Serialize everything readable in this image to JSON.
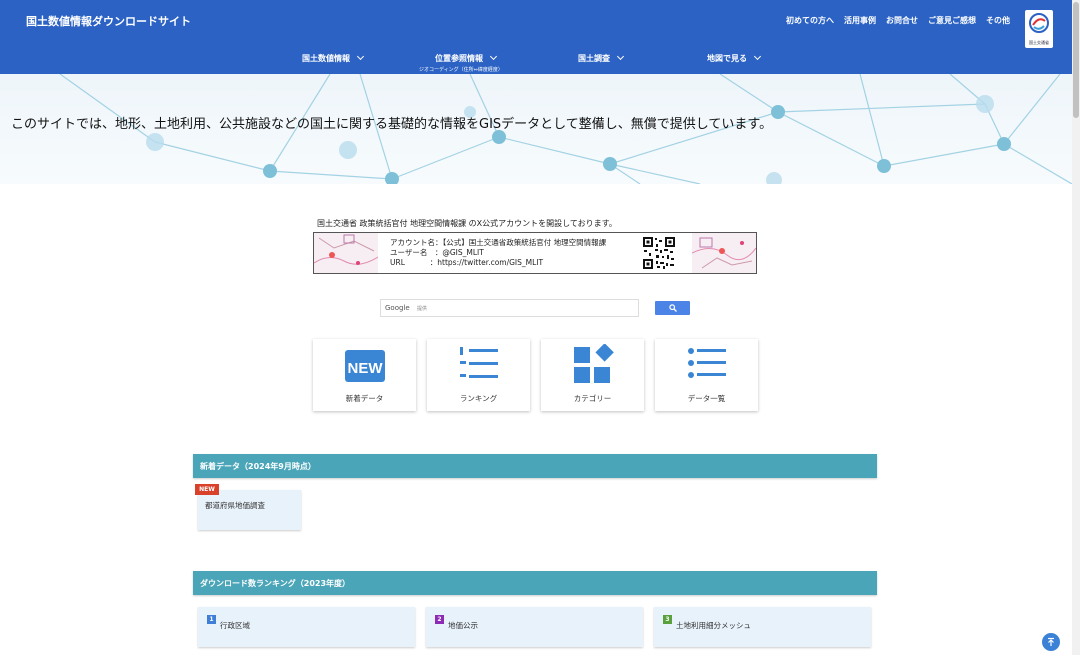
{
  "header": {
    "site_title": "国土数値情報ダウンロードサイト",
    "top_links": [
      "初めての方へ",
      "活用事例",
      "お問合せ",
      "ご意見ご感想",
      "その他"
    ],
    "logo_text": "国土交通省",
    "bg_color": "#2b62c4"
  },
  "nav": {
    "items": [
      {
        "label": "国土数値情報",
        "sub": ""
      },
      {
        "label": "位置参照情報",
        "sub": "ジオコーディング（住所⇔緯度経度）"
      },
      {
        "label": "国土調査",
        "sub": ""
      },
      {
        "label": "地図で見る",
        "sub": ""
      }
    ]
  },
  "hero": {
    "text": "このサイトでは、地形、土地利用、公共施設などの国土に関する基礎的な情報をGISデータとして整備し、無償で提供しています。"
  },
  "x_account": {
    "caption": "国土交通省 政策統括官付 地理空間情報課 のX公式アカウントを開設しております。",
    "lines": [
      "アカウント名：【公式】国土交通省政策統括官付 地理空間情報課",
      "ユーザー名　：@GIS_MLIT",
      "URL　　　 ：https://twitter.com/GIS_MLIT"
    ]
  },
  "search": {
    "brand": "Google",
    "brand_sub": "提供"
  },
  "quick_links": [
    {
      "label": "新着データ",
      "icon": "new-icon"
    },
    {
      "label": "ランキング",
      "icon": "ranking-list-icon"
    },
    {
      "label": "カテゴリー",
      "icon": "category-icon"
    },
    {
      "label": "データ一覧",
      "icon": "list-icon"
    }
  ],
  "new_data": {
    "heading": "新着データ（2024年9月時点）",
    "badge": "NEW",
    "items": [
      "都道府県地価調査"
    ]
  },
  "ranking": {
    "heading": "ダウンロード数ランキング（2023年度）",
    "items": [
      {
        "rank": "1",
        "label": "行政区域",
        "color": "#3f7fd8"
      },
      {
        "rank": "2",
        "label": "地価公示",
        "color": "#8e2bb5"
      },
      {
        "rank": "3",
        "label": "土地利用細分メッシュ",
        "color": "#5aa03c"
      }
    ]
  }
}
